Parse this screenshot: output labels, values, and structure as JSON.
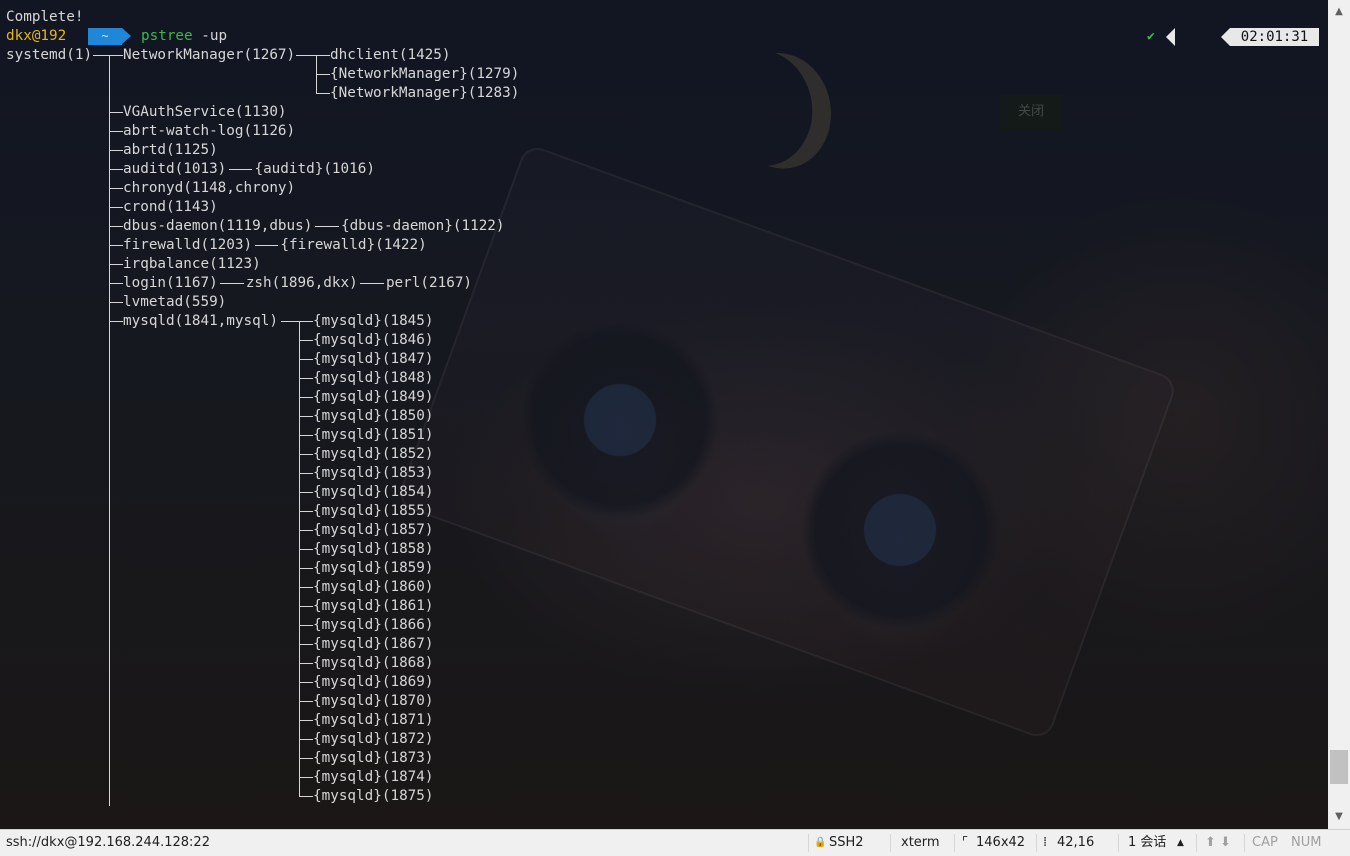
{
  "terminal": {
    "header_line": "Complete!",
    "prompt": {
      "user_host": "dkx@192",
      "directory": "~",
      "command": "pstree",
      "args": " -up"
    },
    "status_check": "✔",
    "clock": "02:01:31",
    "background_close_label": "关闭",
    "tree": {
      "root": "systemd(1)",
      "network_manager": "NetworkManager(1267)",
      "nm_children": [
        "dhclient(1425)",
        "{NetworkManager}(1279)",
        "{NetworkManager}(1283)"
      ],
      "services": [
        "VGAuthService(1130)",
        "abrt-watch-log(1126)",
        "abrtd(1125)",
        "auditd(1013)",
        "chronyd(1148,chrony)",
        "crond(1143)",
        "dbus-daemon(1119,dbus)",
        "firewalld(1203)",
        "irqbalance(1123)",
        "login(1167)",
        "lvmetad(559)",
        "mysqld(1841,mysql)"
      ],
      "auditd_child": "{auditd}(1016)",
      "dbus_child": "{dbus-daemon}(1122)",
      "firewalld_child": "{firewalld}(1422)",
      "login_child": "zsh(1896,dkx)",
      "zsh_child": "perl(2167)",
      "mysqld_threads": [
        "{mysqld}(1845)",
        "{mysqld}(1846)",
        "{mysqld}(1847)",
        "{mysqld}(1848)",
        "{mysqld}(1849)",
        "{mysqld}(1850)",
        "{mysqld}(1851)",
        "{mysqld}(1852)",
        "{mysqld}(1853)",
        "{mysqld}(1854)",
        "{mysqld}(1855)",
        "{mysqld}(1857)",
        "{mysqld}(1858)",
        "{mysqld}(1859)",
        "{mysqld}(1860)",
        "{mysqld}(1861)",
        "{mysqld}(1866)",
        "{mysqld}(1867)",
        "{mysqld}(1868)",
        "{mysqld}(1869)",
        "{mysqld}(1870)",
        "{mysqld}(1871)",
        "{mysqld}(1872)",
        "{mysqld}(1873)",
        "{mysqld}(1874)",
        "{mysqld}(1875)"
      ]
    }
  },
  "scrollbar": {
    "up_icon": "▲",
    "down_icon": "▼"
  },
  "status_bar": {
    "connection": "ssh://dkx@192.168.244.128:22",
    "lock_icon": "🔒",
    "protocol": "SSH2",
    "term_type": "xterm",
    "size_icon": "⌜",
    "size": "146x42",
    "cursor_icon": "⁞",
    "cursor_pos": "42,16",
    "sessions": "1 会话",
    "sessions_caret": "▲",
    "nav_arrows": "⬆ ⬇",
    "cap": "CAP",
    "num": "NUM"
  },
  "colors": {
    "prompt_user": "#e6b422",
    "prompt_dir_bg": "#1f86d8",
    "command": "#3cb84a",
    "text": "#d6d6d6"
  }
}
